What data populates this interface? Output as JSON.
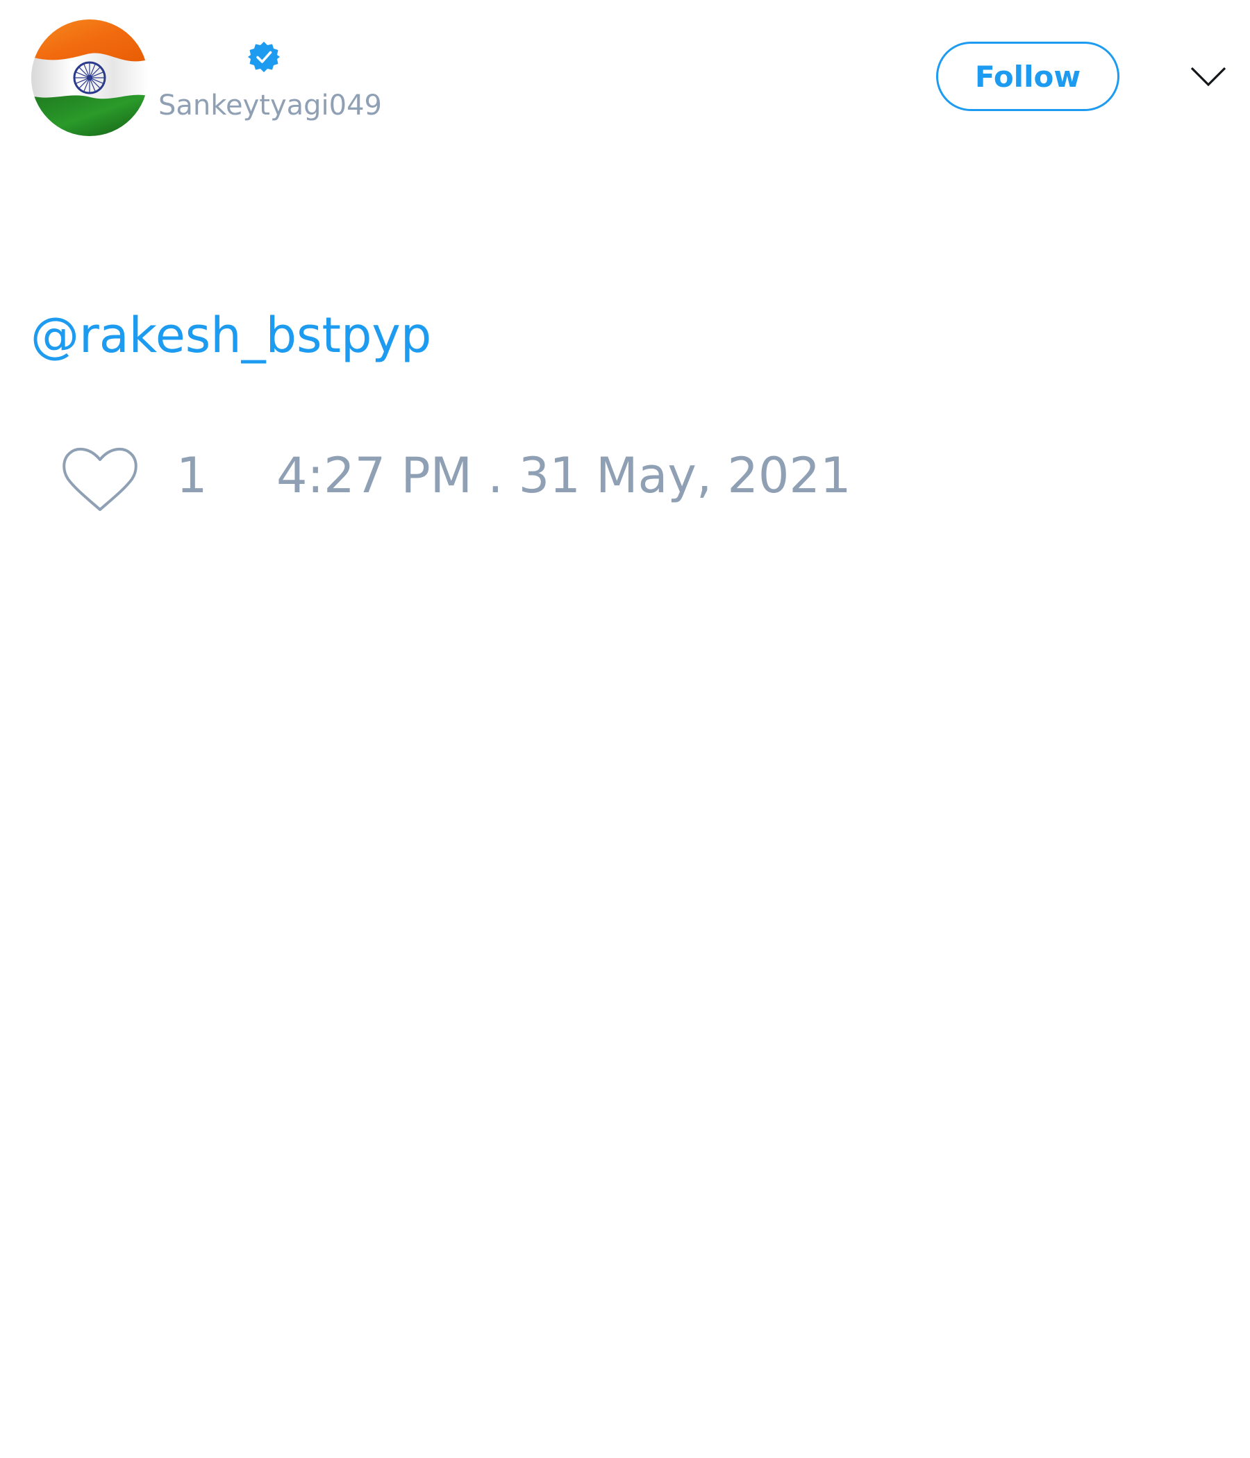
{
  "tweet": {
    "author": {
      "display_name": "",
      "handle": "Sankeytyagi049",
      "verified": true,
      "avatar": "india-flag-avatar"
    },
    "follow_button_label": "Follow",
    "menu_icon": "chevron-down-icon",
    "text": "@rakesh_bstpyp",
    "like_icon": "heart-icon",
    "like_count": "1",
    "timestamp": "4:27 PM . 31 May, 2021"
  },
  "colors": {
    "accent": "#1d9bf0",
    "muted": "#8f9fb4",
    "background": "#ffffff"
  }
}
